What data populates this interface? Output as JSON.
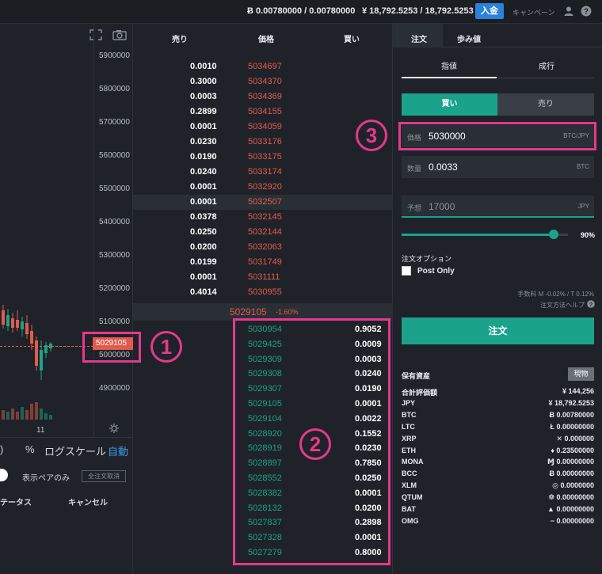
{
  "topbar": {
    "btc_balance": "Ƀ 0.00780000 / 0.00780000",
    "jpy_balance": "¥ 18,792.5253 / 18,792.5253",
    "deposit_label": "入金",
    "campaign_label": "キャンペーン",
    "icons": [
      "user-icon",
      "help-icon"
    ]
  },
  "chart": {
    "y_ticks": [
      "5900000",
      "5800000",
      "5700000",
      "5600000",
      "5500000",
      "5400000",
      "5300000",
      "5200000",
      "5100000",
      "5000000",
      "4900000"
    ],
    "current_price": "5029105",
    "x_tick": "11",
    "toolbar": {
      "paren": ")",
      "percent": "%",
      "log_scale": "ログスケール",
      "auto": "自動"
    },
    "filter": {
      "pair_only": "表示ペアのみ",
      "cancel_all": "全注文取消"
    },
    "columns": {
      "status": "テータス",
      "cancel": "キャンセル"
    },
    "accent_down": "#e25a4e",
    "accent_up": "#1aa38a"
  },
  "orderbook": {
    "headers": {
      "sell": "売り",
      "price": "価格",
      "buy": "買い"
    },
    "asks": [
      {
        "qty": "0.0010",
        "price": "5034697"
      },
      {
        "qty": "0.3000",
        "price": "5034370"
      },
      {
        "qty": "0.0003",
        "price": "5034369"
      },
      {
        "qty": "0.2899",
        "price": "5034155"
      },
      {
        "qty": "0.0001",
        "price": "5034059"
      },
      {
        "qty": "0.0230",
        "price": "5033176"
      },
      {
        "qty": "0.0190",
        "price": "5033175"
      },
      {
        "qty": "0.0240",
        "price": "5033174"
      },
      {
        "qty": "0.0001",
        "price": "5032920"
      },
      {
        "qty": "0.0001",
        "price": "5032507"
      },
      {
        "qty": "0.0378",
        "price": "5032145"
      },
      {
        "qty": "0.0250",
        "price": "5032144"
      },
      {
        "qty": "0.0200",
        "price": "5032063"
      },
      {
        "qty": "0.0199",
        "price": "5031749"
      },
      {
        "qty": "0.0001",
        "price": "5031111"
      },
      {
        "qty": "0.4014",
        "price": "5030955"
      }
    ],
    "mid": {
      "price": "5029105",
      "change": "-1.60%"
    },
    "bids": [
      {
        "price": "5030954",
        "qty": "0.9052"
      },
      {
        "price": "5029425",
        "qty": "0.0009"
      },
      {
        "price": "5029309",
        "qty": "0.0003"
      },
      {
        "price": "5029308",
        "qty": "0.0240"
      },
      {
        "price": "5029307",
        "qty": "0.0190"
      },
      {
        "price": "5029105",
        "qty": "0.0001"
      },
      {
        "price": "5029104",
        "qty": "0.0022"
      },
      {
        "price": "5028920",
        "qty": "0.1552"
      },
      {
        "price": "5028919",
        "qty": "0.0230"
      },
      {
        "price": "5028897",
        "qty": "0.7850"
      },
      {
        "price": "5028552",
        "qty": "0.0250"
      },
      {
        "price": "5028382",
        "qty": "0.0001"
      },
      {
        "price": "5028132",
        "qty": "0.0200"
      },
      {
        "price": "5027837",
        "qty": "0.2898"
      },
      {
        "price": "5027328",
        "qty": "0.0001"
      },
      {
        "price": "5027279",
        "qty": "0.8000"
      }
    ]
  },
  "order": {
    "tabs": [
      "注文",
      "歩み値"
    ],
    "subtabs": [
      "指値",
      "成行"
    ],
    "buy_label": "買い",
    "sell_label": "売り",
    "price_field": {
      "label": "価格",
      "value": "5030000",
      "unit": "BTC/JPY"
    },
    "amount_field": {
      "label": "数量",
      "value": "0.0033",
      "unit": "BTC"
    },
    "estimate_field": {
      "label": "予想",
      "value": "17000",
      "unit": "JPY"
    },
    "slider_percent": "90%",
    "slider_fraction": 0.9,
    "options_label": "注文オプション",
    "post_only": "Post Only",
    "fee_text": "手数料 M -0.02% / T 0.12%",
    "howto_text": "注文方法ヘルプ",
    "submit_label": "注文"
  },
  "assets": {
    "title": "保有資産",
    "badge": "現物",
    "rows": [
      {
        "name": "合計評価額",
        "value": "¥ 144,256"
      },
      {
        "name": "JPY",
        "value": "¥ 18,792.5253"
      },
      {
        "name": "BTC",
        "value": "Ƀ 0.00780000"
      },
      {
        "name": "LTC",
        "value": "Ł 0.00000000"
      },
      {
        "name": "XRP",
        "value": "✕ 0.000000"
      },
      {
        "name": "ETH",
        "value": "♦ 0.23500000"
      },
      {
        "name": "MONA",
        "value": "Ɱ 0.00000000"
      },
      {
        "name": "BCC",
        "value": "Ƀ 0.00000000"
      },
      {
        "name": "XLM",
        "value": "◎ 0.0000000"
      },
      {
        "name": "QTUM",
        "value": "❁ 0.00000000"
      },
      {
        "name": "BAT",
        "value": "▲ 0.00000000"
      },
      {
        "name": "OMG",
        "value": "− 0.00000000"
      }
    ]
  },
  "annotations": [
    "1",
    "2",
    "3"
  ]
}
